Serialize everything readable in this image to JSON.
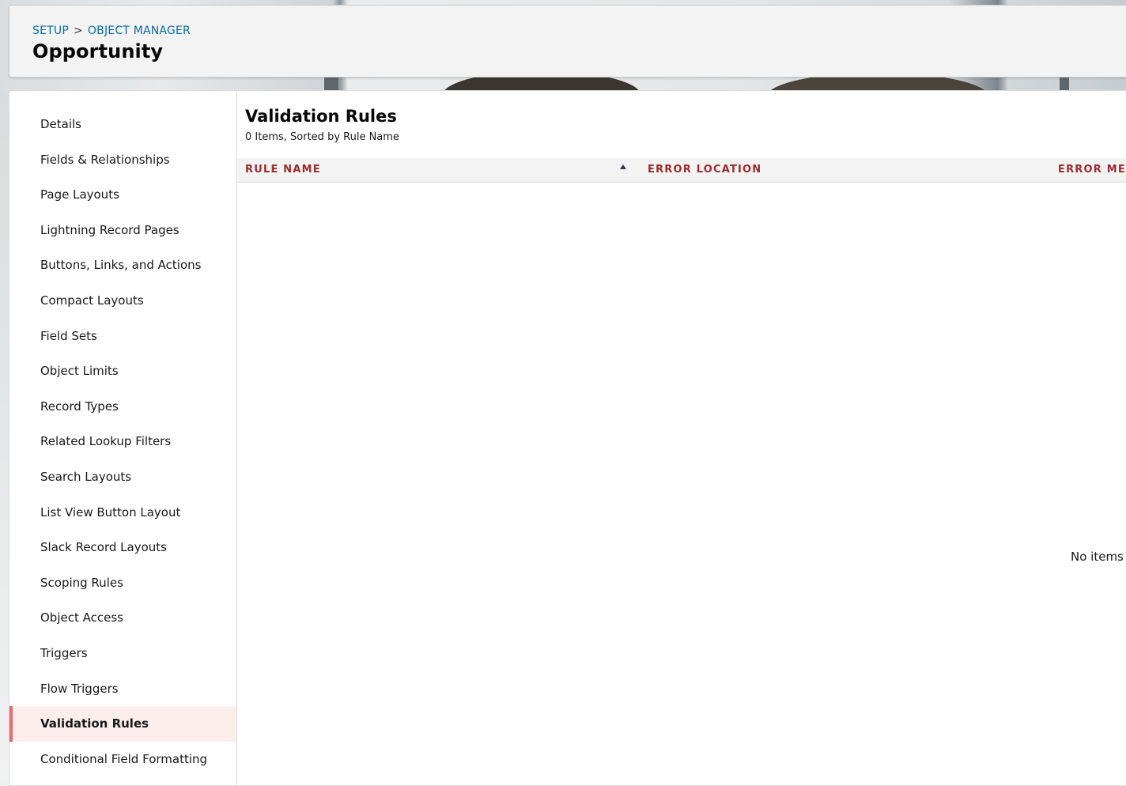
{
  "breadcrumb": {
    "setup": "SETUP",
    "separator": ">",
    "object_manager": "OBJECT MANAGER"
  },
  "object_title": "Opportunity",
  "sidebar": {
    "items": [
      {
        "label": "Details"
      },
      {
        "label": "Fields & Relationships"
      },
      {
        "label": "Page Layouts"
      },
      {
        "label": "Lightning Record Pages"
      },
      {
        "label": "Buttons, Links, and Actions"
      },
      {
        "label": "Compact Layouts"
      },
      {
        "label": "Field Sets"
      },
      {
        "label": "Object Limits"
      },
      {
        "label": "Record Types"
      },
      {
        "label": "Related Lookup Filters"
      },
      {
        "label": "Search Layouts"
      },
      {
        "label": "List View Button Layout"
      },
      {
        "label": "Slack Record Layouts"
      },
      {
        "label": "Scoping Rules"
      },
      {
        "label": "Object Access"
      },
      {
        "label": "Triggers"
      },
      {
        "label": "Flow Triggers"
      },
      {
        "label": "Validation Rules"
      },
      {
        "label": "Conditional Field Formatting"
      }
    ],
    "active_item": "Validation Rules"
  },
  "content": {
    "title": "Validation Rules",
    "subtitle": "0 Items, Sorted by Rule Name",
    "columns": {
      "rule_name": "RULE NAME",
      "error_location": "ERROR LOCATION",
      "error_message": "ERROR MES"
    },
    "sort_icon": "arrow-up-icon",
    "empty_text": "No items t"
  },
  "colors": {
    "link": "#0b6da3",
    "column_header": "#9e2a2b",
    "active_bg": "#fdeeee",
    "active_bar": "#e66a6a"
  }
}
